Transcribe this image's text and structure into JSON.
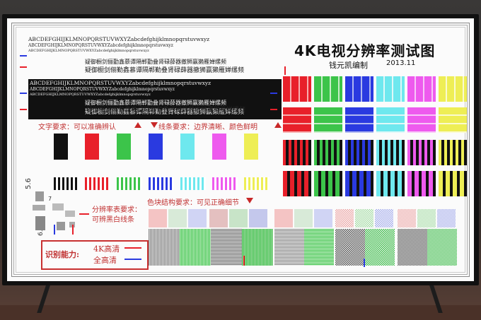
{
  "chart": {
    "title": "4K电视分辨率测试图",
    "author": "钱元凯编制",
    "year": "2013.11"
  },
  "text_samples": {
    "line1": "ABCDEFGHIJKLMNOPQRSTUVWXYZabcdefghijklmnopqrstuvwxyz",
    "line2": "ABCDEFGHIJKLMNOPQRSTUVWXYZabcdefghijklmnopqrstuvwxyz",
    "line3": "ABCDEFGHIJKLMNOPQRSTUVWXYZabcdefghijklmnopqrstuvwxyz",
    "cn1": "疑御橱剑俪勤鑫慕谭隔郸勤叠肾碌薛器撤狮赢獭雁婵缧频",
    "cn2": "疑御橱剑俪勤鑫慕谭隔郸勤叠肾碌薛器撤狮赢獭雁婵缧频",
    "white_line1": "ABCDEFGHIJKLMNOPQRSTUVWXYZabcdefghijklmnopqrstuvwxyz",
    "white_line2": "ABCDEFGHIJKLMNOPQRSTUVWXYZabcdefghijklmnopqrstuvwxyz",
    "white_line3": "ABCDEFGHIJKLMNOPQRSTUVWXYZabcdefghijklmnopqrstuvwxyz",
    "white_cn1": "疑御橱剑俪勤鑫慕谭隔郸勤叠肾碌薛器撤狮赢獭雁婵缧频",
    "white_cn2": "疑御橱剑俪勤鑫慕谭隔郸勤叠肾碌薛器撤狮赢獭雁婵缧频"
  },
  "labels": {
    "text_req": "文字要求：可以准确辨认",
    "line_req": "线条要求：边界清晰、颜色鲜明",
    "res_req1": "分辨率表要求：",
    "res_req2": "可辨黑白线条",
    "block_req": "色块结构要求：可见正确细节",
    "ability": "识别能力:",
    "uhd": "4K高清",
    "fhd": "全高清"
  },
  "res_numbers": {
    "n1": "5.6",
    "n2": "6.3",
    "n3": "7"
  },
  "colors": {
    "red": "#e8202a",
    "green": "#3cc44a",
    "blue": "#2a3ae0",
    "cyan": "#6ee8ee",
    "magenta": "#ee5aee",
    "yellow": "#eeee55",
    "black": "#111111",
    "accent_red": "#c82828"
  }
}
